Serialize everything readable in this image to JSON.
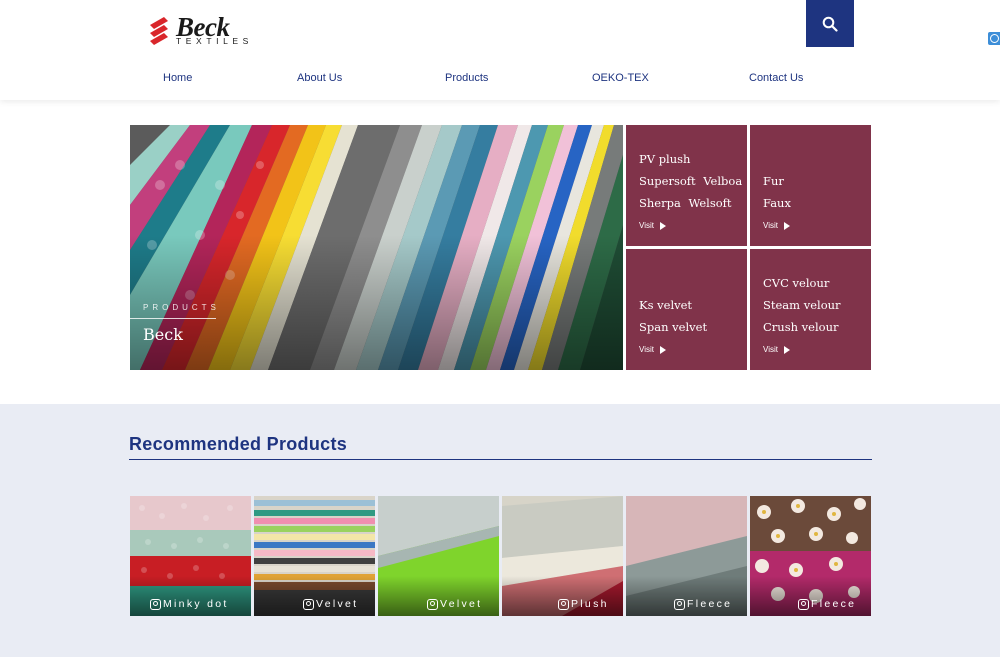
{
  "header": {
    "logo_word": "Beck",
    "logo_sub": "TEXTILES",
    "brand_color": "#1e3480",
    "logo_mark_color": "#d9262b",
    "search_icon": "search-icon"
  },
  "nav": {
    "items": [
      "Home",
      "About Us",
      "Products",
      "OEKO-TEX",
      "Contact Us"
    ]
  },
  "hero": {
    "kicker": "PRODUCTS",
    "title": "Beck"
  },
  "tiles": [
    {
      "lines": [
        "PV plush",
        "Supersoft    Velboa",
        "Sherpa    Welsoft"
      ],
      "visit": "Visit"
    },
    {
      "lines": [
        "Fur",
        "Faux"
      ],
      "visit": "Visit"
    },
    {
      "lines": [
        "Ks velvet",
        "Span velvet"
      ],
      "visit": "Visit"
    },
    {
      "lines": [
        "CVC velour",
        "Steam velour",
        "Crush velour"
      ],
      "visit": "Visit"
    }
  ],
  "tile_color": "#80334a",
  "recommended": {
    "title": "Recommended Products",
    "products": [
      {
        "caption": "Minky dot",
        "icon": "instagram-icon"
      },
      {
        "caption": "Velvet",
        "icon": "instagram-icon"
      },
      {
        "caption": "Velvet",
        "icon": "instagram-icon"
      },
      {
        "caption": "Plush",
        "icon": "instagram-icon"
      },
      {
        "caption": "Fleece",
        "icon": "instagram-icon"
      },
      {
        "caption": "Fleece",
        "icon": "instagram-icon"
      }
    ]
  }
}
